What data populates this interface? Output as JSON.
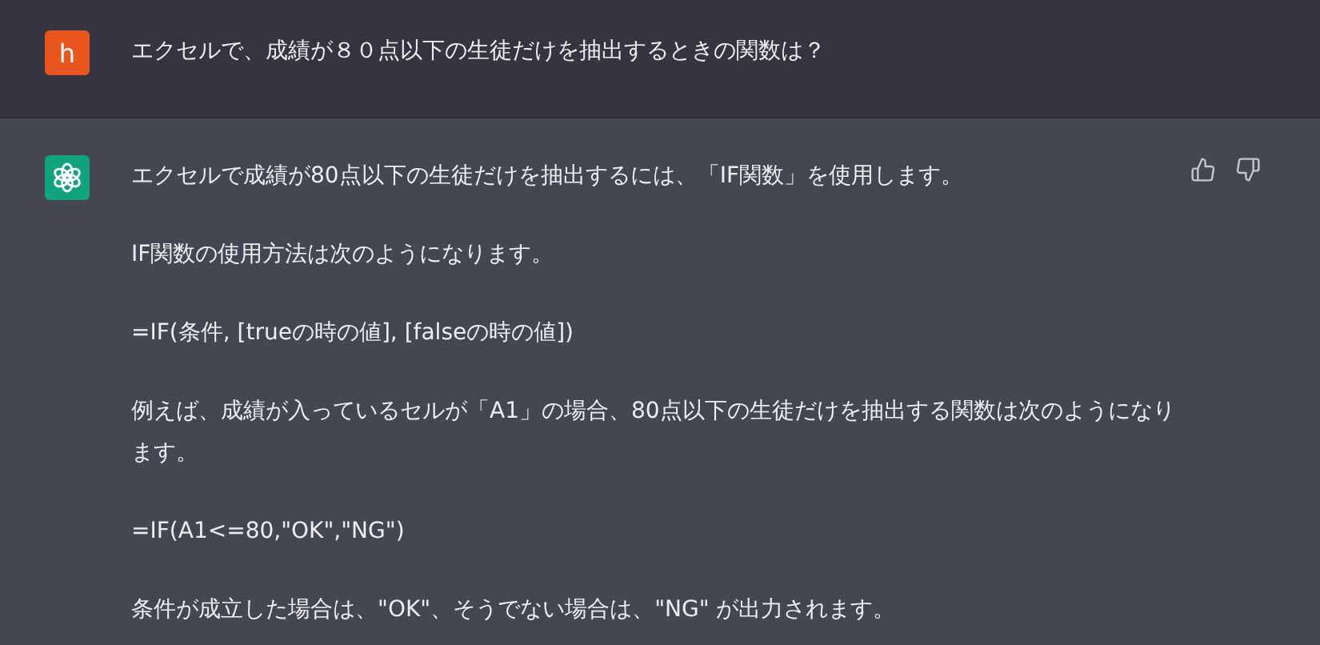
{
  "messages": [
    {
      "kind": "user",
      "avatar": "h",
      "paragraphs": [
        "エクセルで、成績が８０点以下の生徒だけを抽出するときの関数は？"
      ]
    },
    {
      "kind": "assistant",
      "paragraphs": [
        "エクセルで成績が80点以下の生徒だけを抽出するには、「IF関数」を使用します。",
        "IF関数の使用方法は次のようになります。",
        "=IF(条件, [trueの時の値], [falseの時の値])",
        "例えば、成績が入っているセルが「A1」の場合、80点以下の生徒だけを抽出する関数は次のようになります。",
        "=IF(A1<=80,\"OK\",\"NG\")",
        "条件が成立した場合は、\"OK\"、そうでない場合は、\"NG\" が出力されます。"
      ]
    }
  ]
}
